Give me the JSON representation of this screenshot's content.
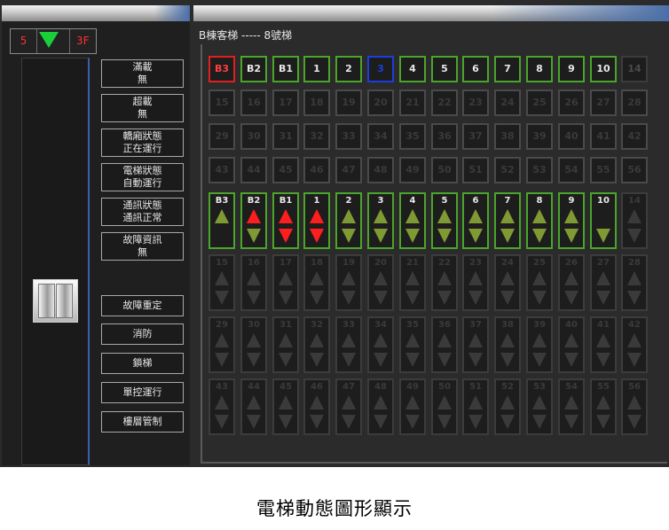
{
  "left_panel": {
    "indicator": {
      "floor_left": "5",
      "floor_right": "3F",
      "direction": "down",
      "direction_color": "#19d03a"
    },
    "status_buttons": [
      {
        "line1": "滿載",
        "line2": "無"
      },
      {
        "line1": "超載",
        "line2": "無"
      },
      {
        "line1": "轎廂狀態",
        "line2": "正在運行"
      },
      {
        "line1": "電梯狀態",
        "line2": "自動運行"
      },
      {
        "line1": "通訊狀態",
        "line2": "通訊正常"
      },
      {
        "line1": "故障資訊",
        "line2": "無"
      }
    ],
    "command_buttons": [
      "故障重定",
      "消防",
      "鎖梯",
      "單控運行",
      "樓層管制"
    ]
  },
  "right_panel": {
    "title": "B棟客梯 ----- 8號梯",
    "floor_rows": [
      [
        {
          "label": "B3",
          "state": "red"
        },
        {
          "label": "B2",
          "state": "active"
        },
        {
          "label": "B1",
          "state": "active"
        },
        {
          "label": "1",
          "state": "active"
        },
        {
          "label": "2",
          "state": "active"
        },
        {
          "label": "3",
          "state": "blue"
        },
        {
          "label": "4",
          "state": "active"
        },
        {
          "label": "5",
          "state": "active"
        },
        {
          "label": "6",
          "state": "active"
        },
        {
          "label": "7",
          "state": "active"
        },
        {
          "label": "8",
          "state": "active"
        },
        {
          "label": "9",
          "state": "active"
        },
        {
          "label": "10",
          "state": "active"
        },
        {
          "label": "14",
          "state": "dim"
        }
      ],
      [
        {
          "label": "15",
          "state": "ghost"
        },
        {
          "label": "16",
          "state": "ghost"
        },
        {
          "label": "17",
          "state": "ghost"
        },
        {
          "label": "18",
          "state": "ghost"
        },
        {
          "label": "19",
          "state": "ghost"
        },
        {
          "label": "20",
          "state": "ghost"
        },
        {
          "label": "21",
          "state": "ghost"
        },
        {
          "label": "22",
          "state": "ghost"
        },
        {
          "label": "23",
          "state": "ghost"
        },
        {
          "label": "24",
          "state": "ghost"
        },
        {
          "label": "25",
          "state": "ghost"
        },
        {
          "label": "26",
          "state": "ghost"
        },
        {
          "label": "27",
          "state": "ghost"
        },
        {
          "label": "28",
          "state": "ghost"
        }
      ],
      [
        {
          "label": "29",
          "state": "ghost"
        },
        {
          "label": "30",
          "state": "ghost"
        },
        {
          "label": "31",
          "state": "ghost"
        },
        {
          "label": "32",
          "state": "ghost"
        },
        {
          "label": "33",
          "state": "ghost"
        },
        {
          "label": "34",
          "state": "ghost"
        },
        {
          "label": "35",
          "state": "ghost"
        },
        {
          "label": "36",
          "state": "ghost"
        },
        {
          "label": "37",
          "state": "ghost"
        },
        {
          "label": "38",
          "state": "ghost"
        },
        {
          "label": "39",
          "state": "ghost"
        },
        {
          "label": "40",
          "state": "ghost"
        },
        {
          "label": "41",
          "state": "ghost"
        },
        {
          "label": "42",
          "state": "ghost"
        }
      ],
      [
        {
          "label": "43",
          "state": "ghost"
        },
        {
          "label": "44",
          "state": "ghost"
        },
        {
          "label": "45",
          "state": "ghost"
        },
        {
          "label": "46",
          "state": "ghost"
        },
        {
          "label": "47",
          "state": "ghost"
        },
        {
          "label": "48",
          "state": "ghost"
        },
        {
          "label": "49",
          "state": "ghost"
        },
        {
          "label": "50",
          "state": "ghost"
        },
        {
          "label": "51",
          "state": "ghost"
        },
        {
          "label": "52",
          "state": "ghost"
        },
        {
          "label": "53",
          "state": "ghost"
        },
        {
          "label": "54",
          "state": "ghost"
        },
        {
          "label": "55",
          "state": "ghost"
        },
        {
          "label": "56",
          "state": "ghost"
        }
      ]
    ],
    "call_rows": [
      [
        {
          "label": "B3",
          "state": "active",
          "up": "green",
          "down": ""
        },
        {
          "label": "B2",
          "state": "active",
          "up": "red",
          "down": "green"
        },
        {
          "label": "B1",
          "state": "active",
          "up": "red",
          "down": "red"
        },
        {
          "label": "1",
          "state": "active",
          "up": "red",
          "down": "red"
        },
        {
          "label": "2",
          "state": "active",
          "up": "green",
          "down": "green"
        },
        {
          "label": "3",
          "state": "active",
          "up": "green",
          "down": "green"
        },
        {
          "label": "4",
          "state": "active",
          "up": "green",
          "down": "green"
        },
        {
          "label": "5",
          "state": "active",
          "up": "green",
          "down": "green"
        },
        {
          "label": "6",
          "state": "active",
          "up": "green",
          "down": "green"
        },
        {
          "label": "7",
          "state": "active",
          "up": "green",
          "down": "green"
        },
        {
          "label": "8",
          "state": "active",
          "up": "green",
          "down": "green"
        },
        {
          "label": "9",
          "state": "active",
          "up": "green",
          "down": "green"
        },
        {
          "label": "10",
          "state": "active",
          "up": "",
          "down": "green"
        },
        {
          "label": "14",
          "state": "ghost",
          "up": "ghost",
          "down": "ghost"
        }
      ],
      [
        {
          "label": "15",
          "state": "ghost"
        },
        {
          "label": "16",
          "state": "ghost"
        },
        {
          "label": "17",
          "state": "ghost"
        },
        {
          "label": "18",
          "state": "ghost"
        },
        {
          "label": "19",
          "state": "ghost"
        },
        {
          "label": "20",
          "state": "ghost"
        },
        {
          "label": "21",
          "state": "ghost"
        },
        {
          "label": "22",
          "state": "ghost"
        },
        {
          "label": "23",
          "state": "ghost"
        },
        {
          "label": "24",
          "state": "ghost"
        },
        {
          "label": "25",
          "state": "ghost"
        },
        {
          "label": "26",
          "state": "ghost"
        },
        {
          "label": "27",
          "state": "ghost"
        },
        {
          "label": "28",
          "state": "ghost"
        }
      ],
      [
        {
          "label": "29",
          "state": "ghost"
        },
        {
          "label": "30",
          "state": "ghost"
        },
        {
          "label": "31",
          "state": "ghost"
        },
        {
          "label": "32",
          "state": "ghost"
        },
        {
          "label": "33",
          "state": "ghost"
        },
        {
          "label": "34",
          "state": "ghost"
        },
        {
          "label": "35",
          "state": "ghost"
        },
        {
          "label": "36",
          "state": "ghost"
        },
        {
          "label": "37",
          "state": "ghost"
        },
        {
          "label": "38",
          "state": "ghost"
        },
        {
          "label": "39",
          "state": "ghost"
        },
        {
          "label": "40",
          "state": "ghost"
        },
        {
          "label": "41",
          "state": "ghost"
        },
        {
          "label": "42",
          "state": "ghost"
        }
      ],
      [
        {
          "label": "43",
          "state": "ghost"
        },
        {
          "label": "44",
          "state": "ghost"
        },
        {
          "label": "45",
          "state": "ghost"
        },
        {
          "label": "46",
          "state": "ghost"
        },
        {
          "label": "47",
          "state": "ghost"
        },
        {
          "label": "48",
          "state": "ghost"
        },
        {
          "label": "49",
          "state": "ghost"
        },
        {
          "label": "50",
          "state": "ghost"
        },
        {
          "label": "51",
          "state": "ghost"
        },
        {
          "label": "52",
          "state": "ghost"
        },
        {
          "label": "53",
          "state": "ghost"
        },
        {
          "label": "54",
          "state": "ghost"
        },
        {
          "label": "55",
          "state": "ghost"
        },
        {
          "label": "56",
          "state": "ghost"
        }
      ]
    ]
  },
  "caption": "電梯動態圖形顯示"
}
